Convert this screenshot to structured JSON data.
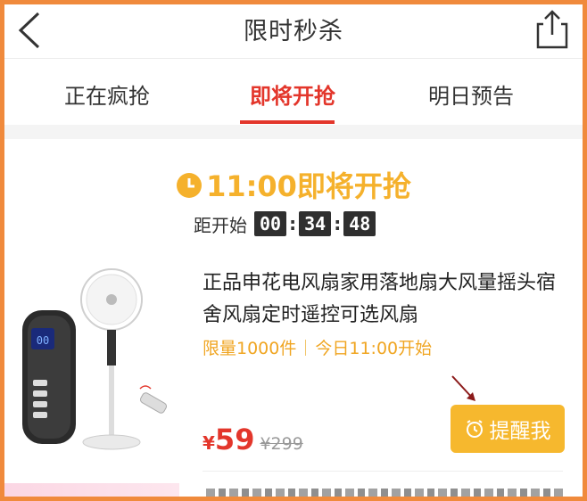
{
  "header": {
    "title": "限时秒杀",
    "back_icon": "chevron-left-icon",
    "share_icon": "share-icon"
  },
  "tabs": [
    {
      "label": "正在疯抢",
      "active": false
    },
    {
      "label": "即将开抢",
      "active": true
    },
    {
      "label": "明日预告",
      "active": false
    }
  ],
  "session": {
    "start_text": "11:00即将开抢",
    "countdown_label": "距开始",
    "hours": "00",
    "minutes": "34",
    "seconds": "48"
  },
  "product": {
    "name": "正品申花电风扇家用落地扇大风量摇头宿舍风扇定时遥控可选风扇",
    "limit_text": "限量1000件",
    "start_time_text": "今日11:00开始",
    "currency": "¥",
    "price": "59",
    "original_price": "¥299",
    "remind_label": "提醒我"
  },
  "colors": {
    "accent_red": "#e3362b",
    "accent_orange": "#f6b82e",
    "frame": "#f08a3c"
  }
}
